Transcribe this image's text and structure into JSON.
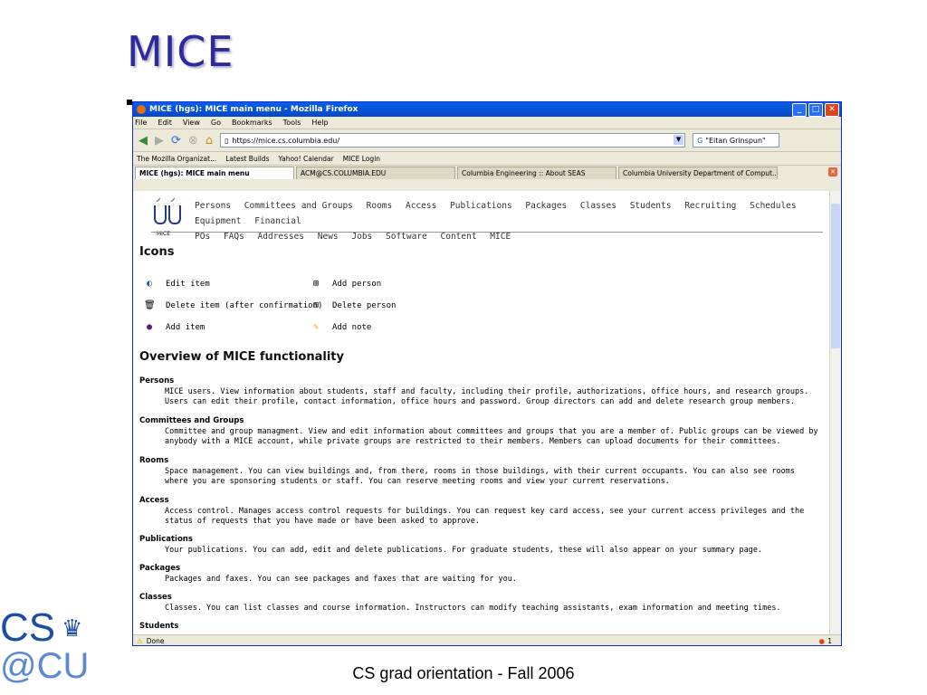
{
  "slide": {
    "title": "MICE",
    "footer": "CS grad orientation - Fall 2006",
    "logo_top": "CS",
    "logo_bottom": "@CU"
  },
  "window": {
    "title": "MICE (hgs): MICE main menu - Mozilla Firefox",
    "menu": [
      "File",
      "Edit",
      "View",
      "Go",
      "Bookmarks",
      "Tools",
      "Help"
    ],
    "url": "https://mice.cs.columbia.edu/",
    "search": "\"Eitan Grinspun\"",
    "bookmarks": [
      "The Mozilla Organizat...",
      "Latest Builds",
      "Yahoo! Calendar",
      "MICE Login"
    ],
    "tabs": [
      "MICE (hgs): MICE main menu",
      "ACM@CS.COLUMBIA.EDU",
      "Columbia Engineering :: About SEAS",
      "Columbia University Department of Comput..."
    ],
    "status": "Done",
    "status_count": "1"
  },
  "page": {
    "logo_caption": "MICE",
    "nav_row1": [
      "Persons",
      "Committees and Groups",
      "Rooms",
      "Access",
      "Publications",
      "Packages",
      "Classes",
      "Students",
      "Recruiting",
      "Schedules",
      "Equipment",
      "Financial"
    ],
    "nav_row2": [
      "POs",
      "FAQs",
      "Addresses",
      "News",
      "Jobs",
      "Software",
      "Content",
      "MICE"
    ],
    "icons_heading": "Icons",
    "icons": {
      "edit": "Edit item",
      "delete": "Delete item (after confirmation)",
      "add": "Add item",
      "add_person": "Add person",
      "delete_person": "Delete person",
      "add_note": "Add note"
    },
    "overview_heading": "Overview of MICE functionality",
    "items": [
      {
        "title": "Persons",
        "text": "MICE users. View information about students, staff and faculty, including their profile, authorizations, office hours, and research groups. Users can edit their profile, contact information, office hours and password. Group directors can add and delete research group members."
      },
      {
        "title": "Committees and Groups",
        "text": "Committee and group managment. View and edit information about committees and groups that you are a member of. Public groups can be viewed by anybody with a MICE account, while private groups are restricted to their members. Members can upload documents for their committees."
      },
      {
        "title": "Rooms",
        "text": "Space management. You can view buildings and, from there, rooms in those buildings, with their current occupants. You can also see rooms where you are sponsoring students or staff. You can reserve meeting rooms and view your current reservations."
      },
      {
        "title": "Access",
        "text": "Access control. Manages access control requests for buildings. You can request key card access, see your current access privileges and the status of requests that you have made or have been asked to approve."
      },
      {
        "title": "Publications",
        "text": "Your publications. You can add, edit and delete publications. For graduate students, these will also appear on your summary page."
      },
      {
        "title": "Packages",
        "text": "Packages and faxes. You can see packages and faxes that are waiting for you."
      },
      {
        "title": "Classes",
        "text": "Classes. You can list classes and course information. Instructors can modify teaching assistants, exam information and meeting times."
      },
      {
        "title": "Students",
        "text": ""
      }
    ]
  }
}
